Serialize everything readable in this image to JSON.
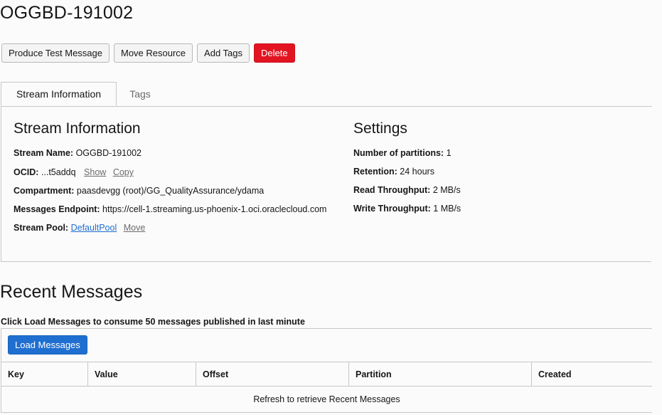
{
  "page": {
    "title": "OGGBD-191002"
  },
  "actions": {
    "produce_test_message": "Produce Test Message",
    "move_resource": "Move Resource",
    "add_tags": "Add Tags",
    "delete": "Delete"
  },
  "tabs": [
    {
      "label": "Stream Information",
      "active": true
    },
    {
      "label": "Tags",
      "active": false
    }
  ],
  "stream_info": {
    "heading": "Stream Information",
    "name_label": "Stream Name:",
    "name_value": "OGGBD-191002",
    "ocid_label": "OCID:",
    "ocid_value": "...t5addq",
    "ocid_show": "Show",
    "ocid_copy": "Copy",
    "compartment_label": "Compartment:",
    "compartment_value": "paasdevgg (root)/GG_QualityAssurance/ydama",
    "endpoint_label": "Messages Endpoint:",
    "endpoint_value": "https://cell-1.streaming.us-phoenix-1.oci.oraclecloud.com",
    "pool_label": "Stream Pool:",
    "pool_value": "DefaultPool",
    "pool_move": "Move"
  },
  "settings": {
    "heading": "Settings",
    "partitions_label": "Number of partitions:",
    "partitions_value": "1",
    "retention_label": "Retention:",
    "retention_value": "24 hours",
    "read_label": "Read Throughput:",
    "read_value": "2 MB/s",
    "write_label": "Write Throughput:",
    "write_value": "1 MB/s"
  },
  "recent": {
    "heading": "Recent Messages",
    "hint": "Click Load Messages to consume 50 messages published in last minute",
    "load_button": "Load Messages",
    "columns": [
      "Key",
      "Value",
      "Offset",
      "Partition",
      "Created"
    ],
    "empty_text": "Refresh to retrieve Recent Messages"
  },
  "colors": {
    "danger": "#e31421",
    "primary": "#1f6fd1"
  }
}
